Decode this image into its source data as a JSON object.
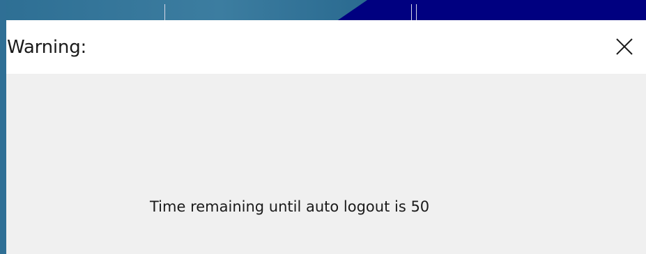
{
  "dialog": {
    "title": "Warning:",
    "message": "Time remaining until auto logout is 50",
    "close_icon": "close-icon"
  },
  "colors": {
    "background_header": "#000080",
    "background_accent": "#3c7da0",
    "dialog_titlebar": "#ffffff",
    "dialog_body": "#f0f0f0",
    "text": "#1a1a1a"
  }
}
